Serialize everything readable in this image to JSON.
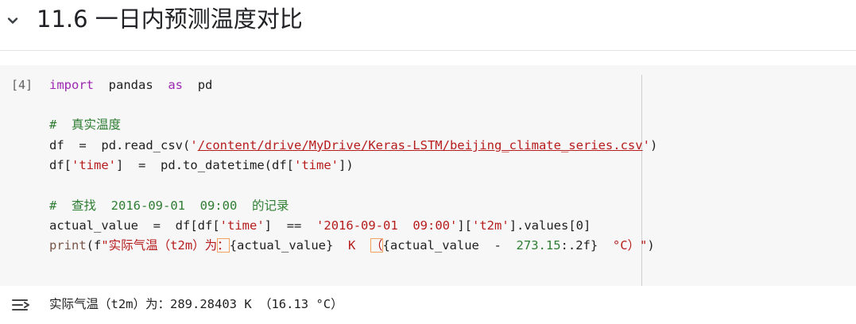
{
  "section": {
    "title": "11.6 一日内预测温度对比",
    "toggle_icon": "chevron-down-icon"
  },
  "cell": {
    "execution_count": "[4]",
    "lines": {
      "l1": {
        "import": "import",
        "mod": "pandas",
        "as": "as",
        "alias": "pd"
      },
      "l2": {
        "comment": "#  真实温度"
      },
      "l3": {
        "lhs": "df",
        "eq": "=",
        "call": "pd.read_csv(",
        "q1": "'",
        "path": "/content/drive/MyDrive/Keras-LSTM/beijing_climate_series.csv",
        "q2": "'",
        "close": ")"
      },
      "l4": {
        "lhs": "df[",
        "key": "'time'",
        "rb": "]",
        "eq": "=",
        "call": "pd.to_datetime(df[",
        "key2": "'time'",
        "close": "])"
      },
      "l5": {
        "comment": "#  查找  2016-09-01  09:00  的记录"
      },
      "l6": {
        "lhs": "actual_value",
        "eq": "=",
        "df": "df[df[",
        "key": "'time'",
        "rb": "]",
        "op": "==",
        "val": "'2016-09-01  09:00'",
        "mid": "][",
        "key2": "'t2m'",
        "tail": "].values[0]"
      },
      "l7": {
        "fn": "print",
        "open": "(f",
        "s1": "\"实际气温（t2m）为",
        "colon": "：",
        "v1": "{actual_value}",
        "s2": "K",
        "paren": "（",
        "v2": "{actual_value  -  ",
        "num": "273.15",
        "fmt": ":.2f}",
        "s3": "°C）\"",
        "close": ")"
      }
    }
  },
  "output": {
    "icon": "output-toggle-icon",
    "text": "实际气温（t2m）为：289.28403 K （16.13 °C）"
  }
}
